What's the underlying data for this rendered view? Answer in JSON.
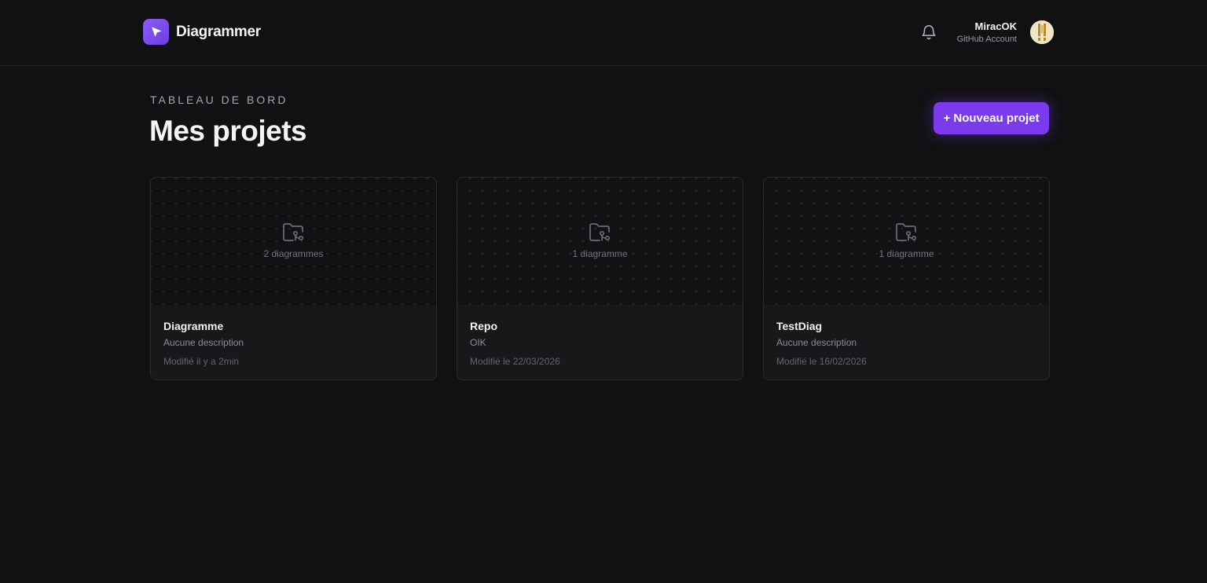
{
  "app": {
    "name": "Diagrammer",
    "logo_icon": "cursor-arrow-icon",
    "accent": "#7c3aed"
  },
  "header": {
    "notification_icon": "bell-icon",
    "user": {
      "name": "MiracOK",
      "subtitle": "GitHub Account"
    }
  },
  "dashboard": {
    "eyebrow": "TABLEAU DE BORD",
    "title": "Mes projets",
    "new_project_label": "+ Nouveau projet"
  },
  "projects": [
    {
      "name": "Diagramme",
      "description": "Aucune description",
      "modified": "Modifié il y a 2min",
      "count_label": "2 diagrammes",
      "icon": "folder-git-icon"
    },
    {
      "name": "Repo",
      "description": "OIK",
      "modified": "Modifié le 22/03/2026",
      "count_label": "1 diagramme",
      "icon": "folder-git-icon"
    },
    {
      "name": "TestDiag",
      "description": "Aucune description",
      "modified": "Modifié le 16/02/2026",
      "count_label": "1 diagramme",
      "icon": "folder-git-icon"
    }
  ]
}
